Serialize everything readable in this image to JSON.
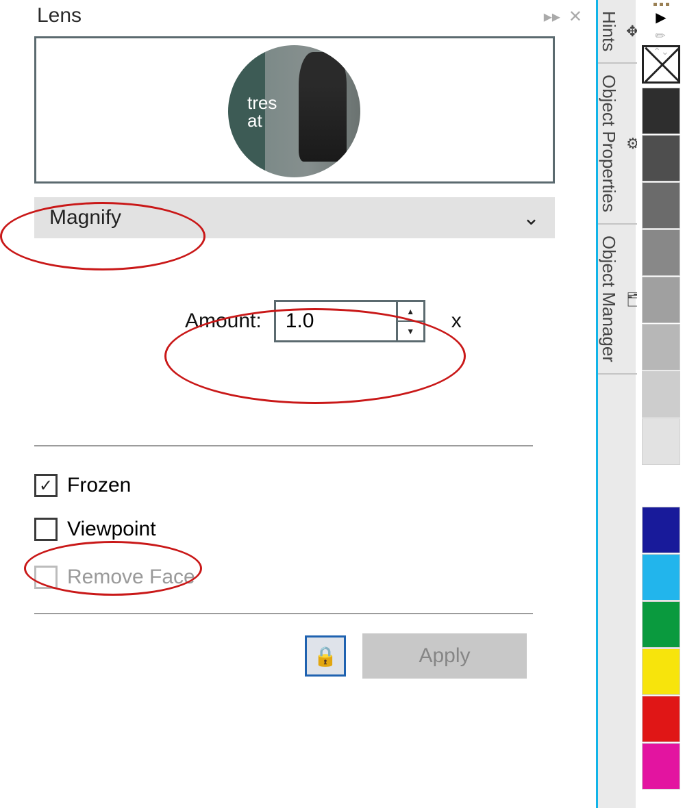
{
  "panel": {
    "title": "Lens",
    "preview_text_line1": "tres",
    "preview_text_line2": "at"
  },
  "dropdown": {
    "selected": "Magnify"
  },
  "amount": {
    "label": "Amount:",
    "value": "1.0",
    "suffix": "x"
  },
  "options": {
    "frozen": {
      "label": "Frozen",
      "checked": true
    },
    "viewpoint": {
      "label": "Viewpoint",
      "checked": false
    },
    "remove_face": {
      "label": "Remove Face",
      "checked": false,
      "disabled": true
    }
  },
  "buttons": {
    "apply": "Apply"
  },
  "docker_tabs": {
    "0": {
      "label": "Hints"
    },
    "1": {
      "label": "Object Properties"
    },
    "2": {
      "label": "Object Manager"
    }
  },
  "swatches": {
    "gray1": "#2e2e2e",
    "gray2": "#4e4e4e",
    "gray3": "#6b6b6b",
    "gray4": "#888888",
    "gray5": "#a0a0a0",
    "gray6": "#b7b7b7",
    "gray7": "#cdcdcd",
    "gray8": "#e2e2e2",
    "navy": "#181a9a",
    "cyan": "#22b5ec",
    "green": "#0a9a3e",
    "yellow": "#f7e40c",
    "red": "#e01616",
    "pink": "#e314a0"
  }
}
